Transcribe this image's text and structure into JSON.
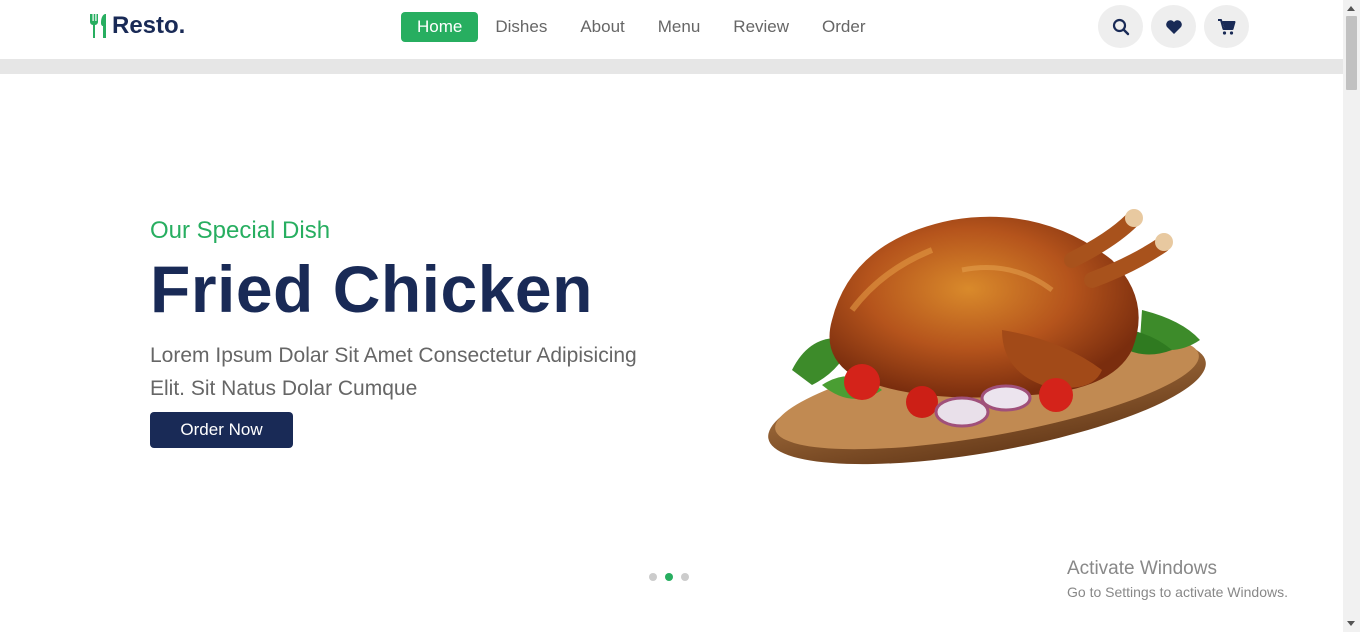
{
  "brand": {
    "name": "Resto.",
    "logo_icon": "utensils-icon",
    "accent": "#27ae60",
    "dark": "#192a56"
  },
  "nav": {
    "items": [
      {
        "label": "Home",
        "active": true
      },
      {
        "label": "Dishes"
      },
      {
        "label": "About"
      },
      {
        "label": "Menu"
      },
      {
        "label": "Review"
      },
      {
        "label": "Order"
      }
    ]
  },
  "header_icons": [
    "search-icon",
    "heart-icon",
    "cart-icon"
  ],
  "hero": {
    "subtitle": "Our Special Dish",
    "title": "Fried Chicken",
    "description_line1": "Lorem Ipsum Dolar Sit Amet Consectetur Adipisicing",
    "description_line2": "Elit. Sit Natus Dolar Cumque",
    "button": "Order Now"
  },
  "slider": {
    "total": 3,
    "active_index": 1
  },
  "watermark": {
    "title": "Activate Windows",
    "subtitle": "Go to Settings to activate Windows."
  }
}
